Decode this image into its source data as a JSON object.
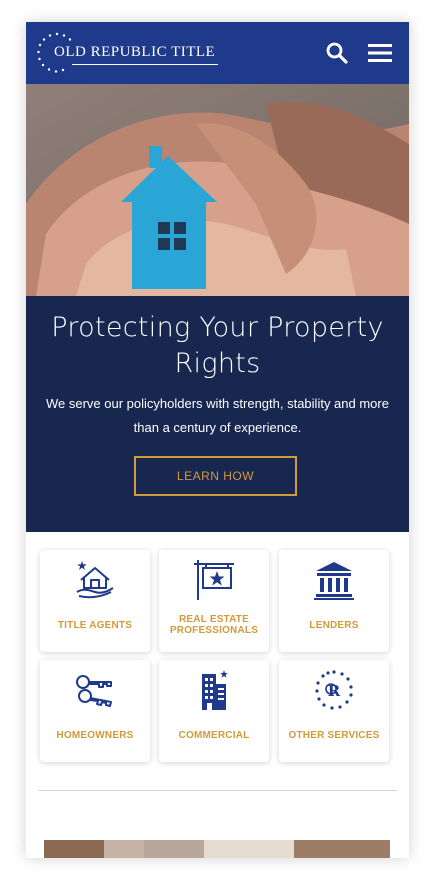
{
  "header": {
    "brand": "OLD REPUBLIC TITLE",
    "search_icon": "search-icon",
    "menu_icon": "hamburger-menu-icon"
  },
  "hero": {
    "image": "hands holding paper house",
    "title": "Protecting Your Property Rights",
    "subtitle": "We serve our policyholders with strength, stability and more than a century of experience.",
    "cta": "LEARN HOW"
  },
  "tiles": [
    {
      "label": "TITLE AGENTS",
      "icon": "house-in-hand-icon"
    },
    {
      "label": "REAL ESTATE PROFESSIONALS",
      "icon": "star-sign-icon"
    },
    {
      "label": "LENDERS",
      "icon": "bank-icon"
    },
    {
      "label": "HOMEOWNERS",
      "icon": "keys-icon"
    },
    {
      "label": "COMMERCIAL",
      "icon": "office-building-icon"
    },
    {
      "label": "OTHER SERVICES",
      "icon": "or-seal-icon"
    }
  ],
  "colors": {
    "header": "#1f3a8a",
    "banner": "#17274f",
    "accent": "#d19a3b",
    "icon": "#1f3a8a"
  }
}
